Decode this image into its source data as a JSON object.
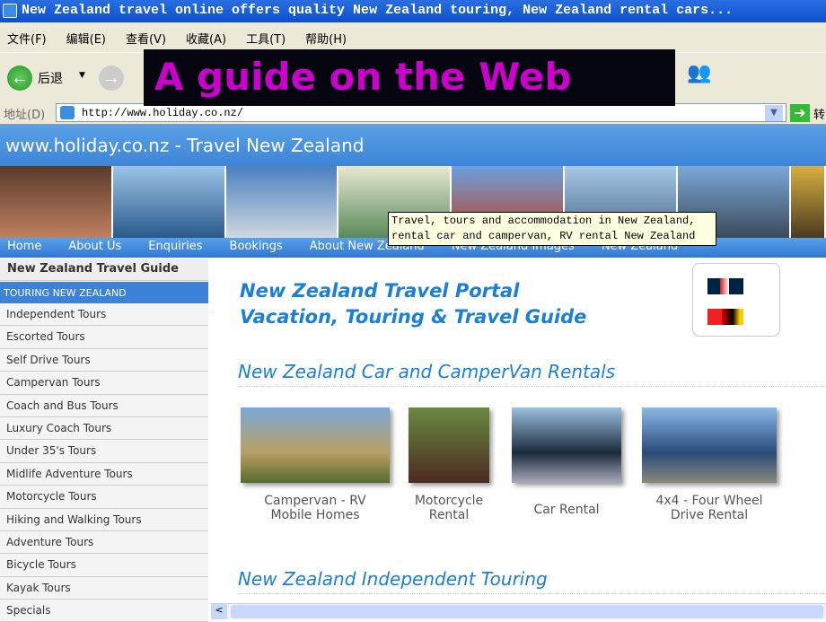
{
  "window": {
    "title": "New Zealand travel online offers quality New Zealand touring, New Zealand rental cars..."
  },
  "menu": [
    "文件(F)",
    "编辑(E)",
    "查看(V)",
    "收藏(A)",
    "工具(T)",
    "帮助(H)"
  ],
  "toolbar": {
    "back_label": "后退"
  },
  "address": {
    "label": "地址(D)",
    "url": "http://www.holiday.co.nz/",
    "go_label": "转"
  },
  "overlay": {
    "text": "A guide on the Web"
  },
  "site": {
    "header": "www.holiday.co.nz - Travel New Zealand",
    "nav": [
      "Home",
      "About Us",
      "Enquiries",
      "Bookings",
      "About New Zealand",
      "New Zealand Images",
      "New Zealand"
    ],
    "tooltip": [
      "Travel, tours and accommodation in New Zealand,",
      "rental car and campervan, RV rental New Zealand"
    ]
  },
  "sidebar": {
    "heading": "New Zealand Travel Guide",
    "section": "TOURING NEW ZEALAND",
    "items": [
      "Independent Tours",
      "Escorted Tours",
      "Self Drive Tours",
      "Campervan Tours",
      "Coach and Bus Tours",
      "Luxury Coach Tours",
      "Under 35's Tours",
      "Midlife Adventure Tours",
      "Motorcycle Tours",
      "Hiking and Walking Tours",
      "Adventure Tours",
      "Bicycle Tours",
      "Kayak Tours",
      "Specials"
    ]
  },
  "main": {
    "title1": "New Zealand Travel Portal",
    "title2": "Vacation, Touring & Travel Guide",
    "section1": "New Zealand Car and CamperVan Rentals",
    "cards": [
      {
        "l1": "Campervan - RV",
        "l2": "Mobile Homes"
      },
      {
        "l1": "Motorcycle",
        "l2": "Rental"
      },
      {
        "l1": "Car Rental",
        "l2": ""
      },
      {
        "l1": "4x4 - Four Wheel",
        "l2": "Drive Rental"
      }
    ],
    "section2": "New Zealand Independent Touring"
  },
  "colors": {
    "accent": "#1b7fd6",
    "overlay_text": "#cc00cc",
    "nav": "#3d85d8"
  }
}
